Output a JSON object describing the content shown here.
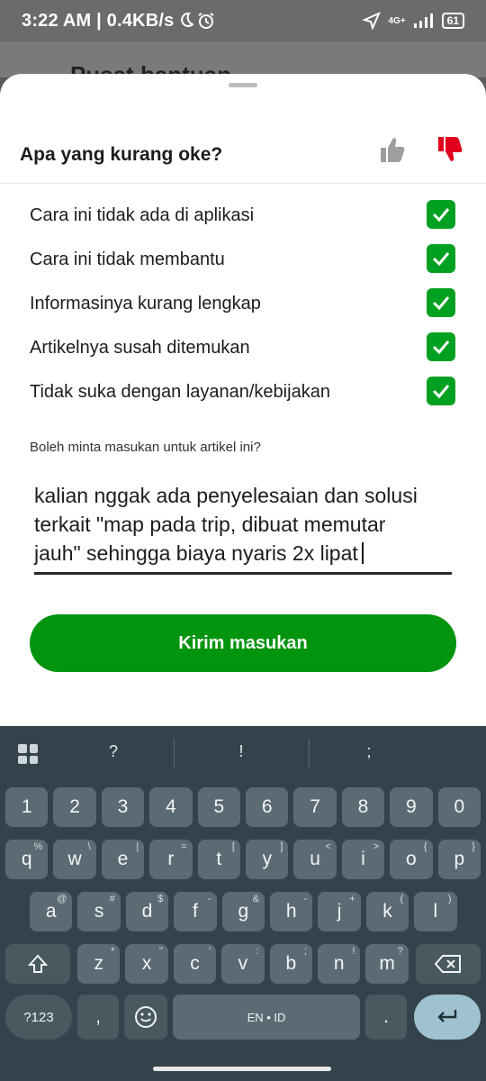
{
  "status_bar": {
    "time": "3:22 AM | 0.4KB/s",
    "network": "4G+",
    "battery": "61"
  },
  "background_page": {
    "title": "Pusat bantuan",
    "back_icon": "arrow-left-icon"
  },
  "sheet": {
    "title": "Apa yang kurang oke?",
    "thumb_up_color": "#9e9e9e",
    "thumb_down_color": "#e0001b",
    "options": [
      {
        "label": "Cara ini tidak ada di aplikasi",
        "checked": true
      },
      {
        "label": "Cara ini tidak membantu",
        "checked": true
      },
      {
        "label": "Informasinya kurang lengkap",
        "checked": true
      },
      {
        "label": "Artikelnya susah ditemukan",
        "checked": true
      },
      {
        "label": "Tidak suka dengan layanan/kebijakan",
        "checked": true
      }
    ],
    "feedback_prompt": "Boleh minta masukan untuk artikel ini?",
    "feedback_lines": [
      "kalian nggak ada penyelesaian dan solusi",
      "terkait \"map pada trip, dibuat memutar",
      "jauh\" sehingga biaya nyaris 2x lipat"
    ],
    "submit_label": "Kirim masukan",
    "accent_color": "#00940f"
  },
  "keyboard": {
    "suggestions": [
      "?",
      "!",
      ";"
    ],
    "number_row": [
      "1",
      "2",
      "3",
      "4",
      "5",
      "6",
      "7",
      "8",
      "9",
      "0"
    ],
    "row1": [
      {
        "k": "q",
        "h": "%"
      },
      {
        "k": "w",
        "h": "\\"
      },
      {
        "k": "e",
        "h": "|"
      },
      {
        "k": "r",
        "h": "="
      },
      {
        "k": "t",
        "h": "["
      },
      {
        "k": "y",
        "h": "]"
      },
      {
        "k": "u",
        "h": "<"
      },
      {
        "k": "i",
        "h": ">"
      },
      {
        "k": "o",
        "h": "{"
      },
      {
        "k": "p",
        "h": "}"
      }
    ],
    "row2": [
      {
        "k": "a",
        "h": "@"
      },
      {
        "k": "s",
        "h": "#"
      },
      {
        "k": "d",
        "h": "$"
      },
      {
        "k": "f",
        "h": "-"
      },
      {
        "k": "g",
        "h": "&"
      },
      {
        "k": "h",
        "h": "-"
      },
      {
        "k": "j",
        "h": "+"
      },
      {
        "k": "k",
        "h": "("
      },
      {
        "k": "l",
        "h": ")"
      }
    ],
    "row3": [
      {
        "k": "z",
        "h": "*"
      },
      {
        "k": "x",
        "h": "\""
      },
      {
        "k": "c",
        "h": "'"
      },
      {
        "k": "v",
        "h": ":"
      },
      {
        "k": "b",
        "h": ";"
      },
      {
        "k": "n",
        "h": "!"
      },
      {
        "k": "m",
        "h": "?"
      }
    ],
    "symbols_label": "?123",
    "comma_label": ",",
    "space_label": "EN • ID",
    "period_label": "."
  }
}
